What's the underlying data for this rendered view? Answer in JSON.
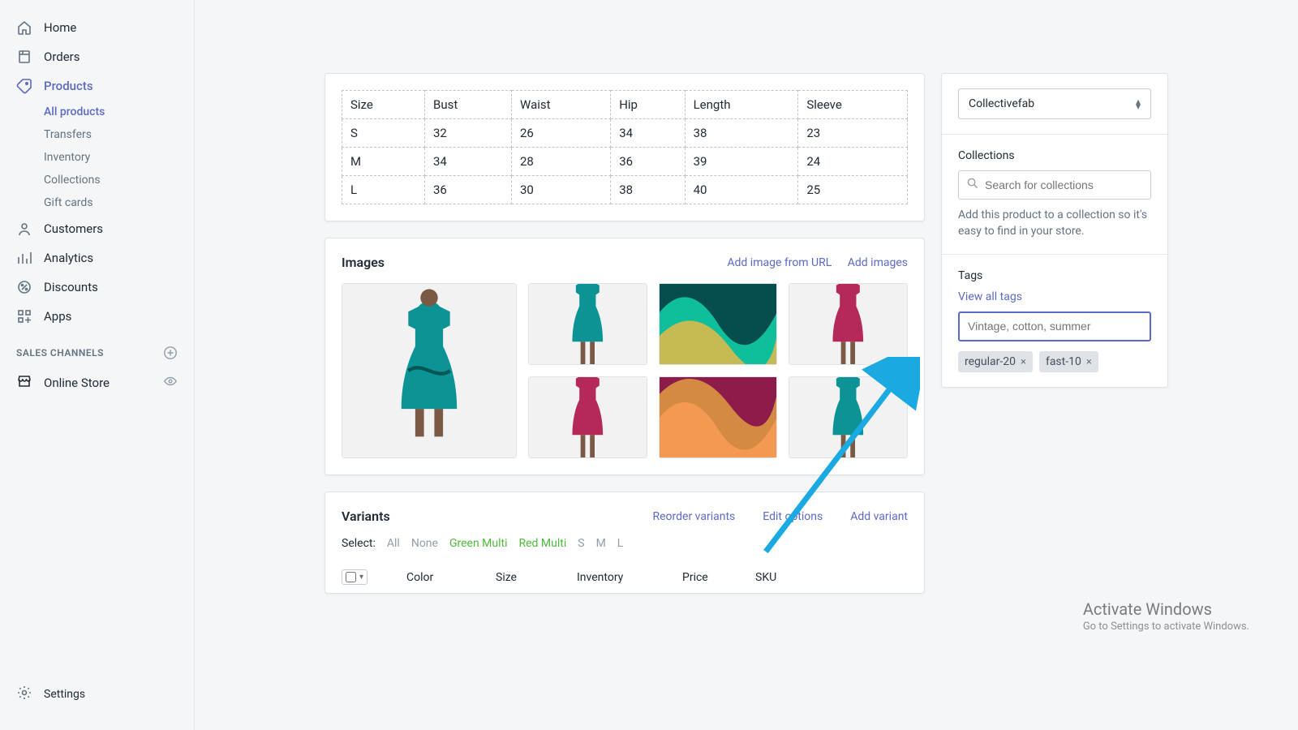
{
  "nav": {
    "home": "Home",
    "orders": "Orders",
    "products": "Products",
    "all_products": "All products",
    "transfers": "Transfers",
    "inventory": "Inventory",
    "collections": "Collections",
    "gift_cards": "Gift cards",
    "customers": "Customers",
    "analytics": "Analytics",
    "discounts": "Discounts",
    "apps": "Apps",
    "sales_channels": "SALES CHANNELS",
    "online_store": "Online Store",
    "settings": "Settings"
  },
  "size_table": {
    "headers": [
      "Size",
      "Bust",
      "Waist",
      "Hip",
      "Length",
      "Sleeve"
    ],
    "rows": [
      [
        "S",
        "32",
        "26",
        "34",
        "38",
        "23"
      ],
      [
        "M",
        "34",
        "28",
        "36",
        "39",
        "24"
      ],
      [
        "L",
        "36",
        "30",
        "38",
        "40",
        "25"
      ]
    ]
  },
  "images": {
    "title": "Images",
    "add_url": "Add image from URL",
    "add_images": "Add images"
  },
  "variants": {
    "title": "Variants",
    "reorder": "Reorder variants",
    "edit": "Edit options",
    "add": "Add variant",
    "select_label": "Select:",
    "all": "All",
    "none": "None",
    "green_multi": "Green Multi",
    "red_multi": "Red Multi",
    "s": "S",
    "m": "M",
    "l": "L",
    "cols": {
      "color": "Color",
      "size": "Size",
      "inventory": "Inventory",
      "price": "Price",
      "sku": "SKU"
    }
  },
  "right": {
    "vendor_value": "Collectivefab",
    "collections_label": "Collections",
    "collections_placeholder": "Search for collections",
    "collections_help": "Add this product to a collection so it's easy to find in your store.",
    "tags_label": "Tags",
    "view_all_tags": "View all tags",
    "tags_placeholder": "Vintage, cotton, summer",
    "tags": [
      "regular-20",
      "fast-10"
    ]
  },
  "activate": {
    "t1": "Activate Windows",
    "t2": "Go to Settings to activate Windows."
  }
}
